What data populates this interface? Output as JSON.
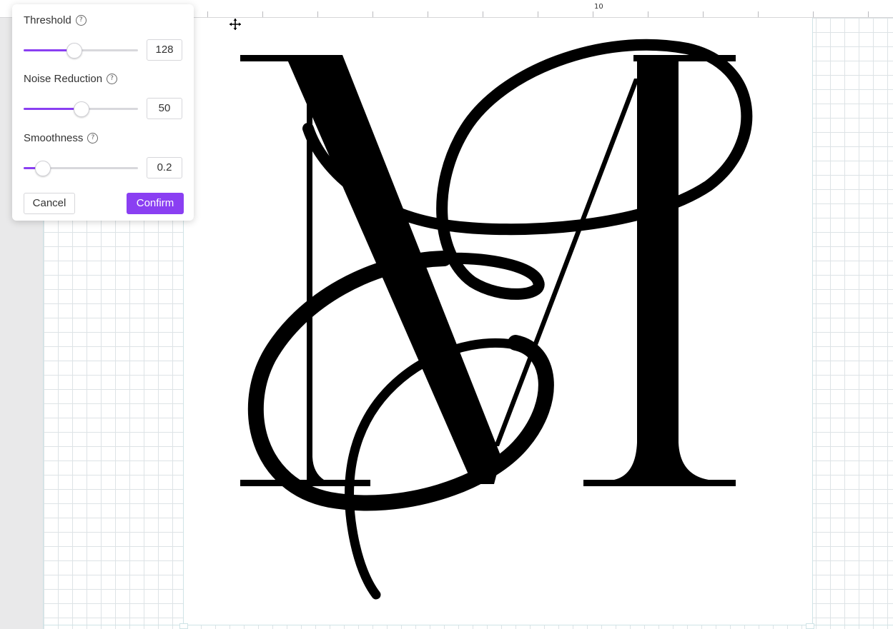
{
  "ruler": {
    "label": "10"
  },
  "filter_panel": {
    "controls": [
      {
        "label": "Threshold",
        "value": "128",
        "fraction": 0.44
      },
      {
        "label": "Noise Reduction",
        "value": "50",
        "fraction": 0.5
      },
      {
        "label": "Smoothness",
        "value": "0.2",
        "fraction": 0.16
      }
    ],
    "help_icon": "question-circle-icon",
    "cancel_label": "Cancel",
    "confirm_label": "Confirm"
  },
  "colors": {
    "accent": "#8a3ff2",
    "artwork": "#000000",
    "grid": "#dde3e6"
  },
  "cursor_icon": "move-cursor-icon"
}
